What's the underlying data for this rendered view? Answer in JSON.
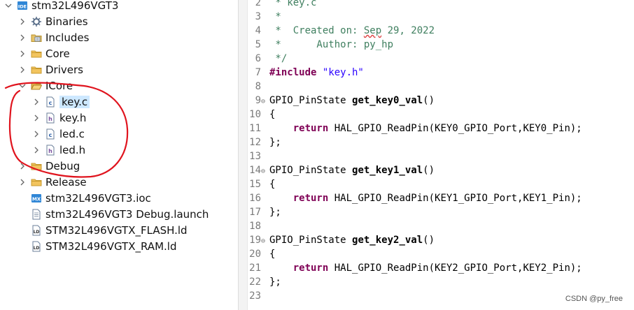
{
  "project_explorer": {
    "items": [
      {
        "label": "stm32L496VGT3",
        "icon": "ide-project-icon",
        "expanded": true
      },
      {
        "label": "Binaries",
        "icon": "binaries-icon",
        "expanded": false
      },
      {
        "label": "Includes",
        "icon": "includes-icon",
        "expanded": false
      },
      {
        "label": "Core",
        "icon": "folder-icon",
        "expanded": false
      },
      {
        "label": "Drivers",
        "icon": "folder-icon",
        "expanded": false
      },
      {
        "label": "ICore",
        "icon": "folder-open-icon",
        "expanded": true
      },
      {
        "label": "key.c",
        "icon": "c-file-icon",
        "selected": true
      },
      {
        "label": "key.h",
        "icon": "h-file-icon"
      },
      {
        "label": "led.c",
        "icon": "c-file-icon"
      },
      {
        "label": "led.h",
        "icon": "h-file-icon"
      },
      {
        "label": "Debug",
        "icon": "folder-icon",
        "expanded": false
      },
      {
        "label": "Release",
        "icon": "folder-icon",
        "expanded": false
      },
      {
        "label": "stm32L496VGT3.ioc",
        "icon": "mx-file-icon"
      },
      {
        "label": "stm32L496VGT3 Debug.launch",
        "icon": "launch-file-icon"
      },
      {
        "label": "STM32L496VGTX_FLASH.ld",
        "icon": "ld-file-icon"
      },
      {
        "label": "STM32L496VGTX_RAM.ld",
        "icon": "ld-file-icon"
      }
    ]
  },
  "editor": {
    "lines": [
      {
        "n": "2",
        "fold": false,
        "parts": [
          {
            "t": " * key.c",
            "c": "cm"
          }
        ]
      },
      {
        "n": "3",
        "fold": false,
        "parts": [
          {
            "t": " *",
            "c": "cm"
          }
        ]
      },
      {
        "n": "4",
        "fold": false,
        "parts": [
          {
            "t": " *  Created on: ",
            "c": "cm"
          },
          {
            "t": "Sep",
            "c": "cmv"
          },
          {
            "t": " 29, 2022",
            "c": "cm"
          }
        ]
      },
      {
        "n": "5",
        "fold": false,
        "parts": [
          {
            "t": " *      Author: py_hp",
            "c": "cm"
          }
        ]
      },
      {
        "n": "6",
        "fold": false,
        "parts": [
          {
            "t": " */",
            "c": "cm"
          }
        ]
      },
      {
        "n": "7",
        "fold": false,
        "parts": [
          {
            "t": "#include ",
            "c": "kw"
          },
          {
            "t": "\"key.h\"",
            "c": "str"
          }
        ]
      },
      {
        "n": "8",
        "fold": false,
        "parts": [
          {
            "t": "",
            "c": "code"
          }
        ]
      },
      {
        "n": "9",
        "fold": true,
        "parts": [
          {
            "t": "GPIO_PinState ",
            "c": "code"
          },
          {
            "t": "get_key0_val",
            "c": "fn"
          },
          {
            "t": "()",
            "c": "code"
          }
        ]
      },
      {
        "n": "10",
        "fold": false,
        "parts": [
          {
            "t": "{",
            "c": "code"
          }
        ]
      },
      {
        "n": "11",
        "fold": false,
        "parts": [
          {
            "t": "    ",
            "c": "code"
          },
          {
            "t": "return",
            "c": "kw"
          },
          {
            "t": " HAL_GPIO_ReadPin(KEY0_GPIO_Port,KEY0_Pin);",
            "c": "code"
          }
        ]
      },
      {
        "n": "12",
        "fold": false,
        "parts": [
          {
            "t": "};",
            "c": "code"
          }
        ]
      },
      {
        "n": "13",
        "fold": false,
        "parts": [
          {
            "t": "",
            "c": "code"
          }
        ]
      },
      {
        "n": "14",
        "fold": true,
        "parts": [
          {
            "t": "GPIO_PinState ",
            "c": "code"
          },
          {
            "t": "get_key1_val",
            "c": "fn"
          },
          {
            "t": "()",
            "c": "code"
          }
        ]
      },
      {
        "n": "15",
        "fold": false,
        "parts": [
          {
            "t": "{",
            "c": "code"
          }
        ]
      },
      {
        "n": "16",
        "fold": false,
        "parts": [
          {
            "t": "    ",
            "c": "code"
          },
          {
            "t": "return",
            "c": "kw"
          },
          {
            "t": " HAL_GPIO_ReadPin(KEY1_GPIO_Port,KEY1_Pin);",
            "c": "code"
          }
        ]
      },
      {
        "n": "17",
        "fold": false,
        "parts": [
          {
            "t": "};",
            "c": "code"
          }
        ]
      },
      {
        "n": "18",
        "fold": false,
        "parts": [
          {
            "t": "",
            "c": "code"
          }
        ]
      },
      {
        "n": "19",
        "fold": true,
        "parts": [
          {
            "t": "GPIO_PinState ",
            "c": "code"
          },
          {
            "t": "get_key2_val",
            "c": "fn"
          },
          {
            "t": "()",
            "c": "code"
          }
        ]
      },
      {
        "n": "20",
        "fold": false,
        "parts": [
          {
            "t": "{",
            "c": "code"
          }
        ]
      },
      {
        "n": "21",
        "fold": false,
        "parts": [
          {
            "t": "    ",
            "c": "code"
          },
          {
            "t": "return",
            "c": "kw"
          },
          {
            "t": " HAL_GPIO_ReadPin(KEY2_GPIO_Port,KEY2_Pin);",
            "c": "code"
          }
        ]
      },
      {
        "n": "22",
        "fold": false,
        "parts": [
          {
            "t": "};",
            "c": "code"
          }
        ]
      },
      {
        "n": "23",
        "fold": false,
        "parts": [
          {
            "t": "",
            "c": "code"
          }
        ]
      }
    ]
  },
  "watermark": "CSDN @py_free",
  "colors": {
    "selection": "#cde8ff",
    "keyword": "#7f0055",
    "comment": "#3f7f5f",
    "string": "#2a00ff",
    "annotation": "#e0141e"
  }
}
